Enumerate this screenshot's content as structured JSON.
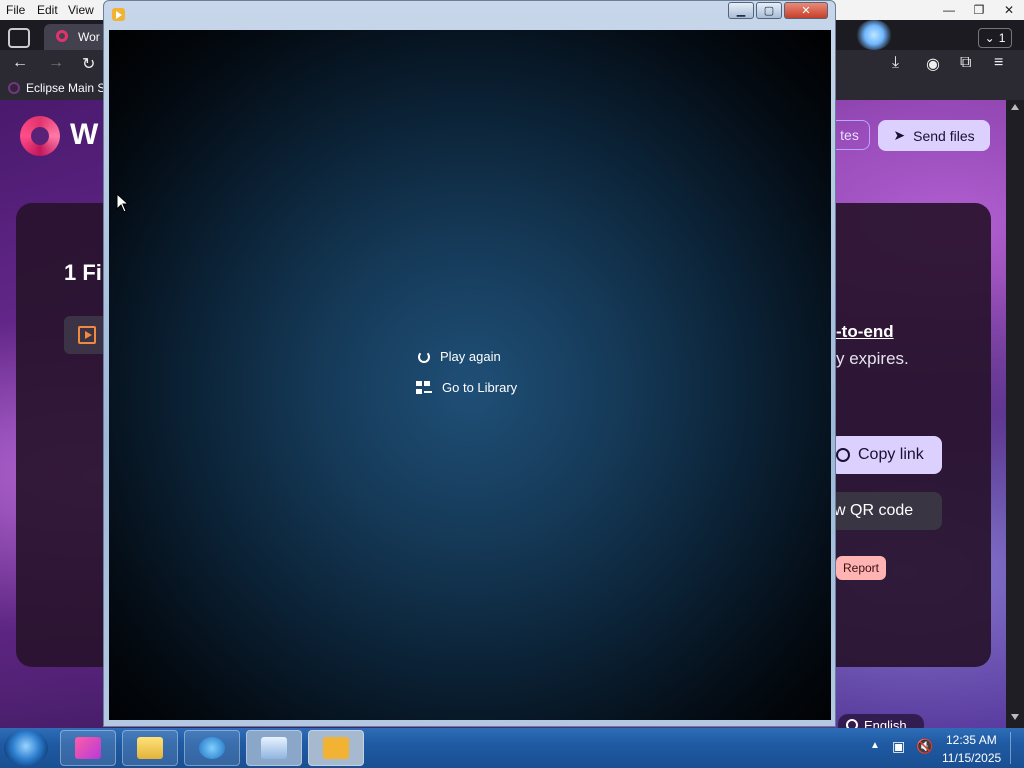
{
  "browser": {
    "menu": [
      "File",
      "Edit",
      "View"
    ],
    "tab_title": "Wor",
    "tab_count": "1",
    "bookmark": "Eclipse Main S"
  },
  "page": {
    "logo_text": "W",
    "notes_button": "tes",
    "send_button": "Send files",
    "files_title": "1 Fi",
    "e2e_text": "-to-end",
    "expires_text": "y expires.",
    "copy_link": "Copy link",
    "qr_code": "w QR code",
    "report": "Report",
    "language": "English"
  },
  "player": {
    "play_again": "Play again",
    "go_to_library": "Go to Library"
  },
  "taskbar": {
    "time": "12:35 AM",
    "date": "11/15/2025"
  },
  "colors": {
    "accent": "#dcd0ff",
    "report_bg": "#ffb3b3",
    "taskbar": "#1f5aa2"
  }
}
